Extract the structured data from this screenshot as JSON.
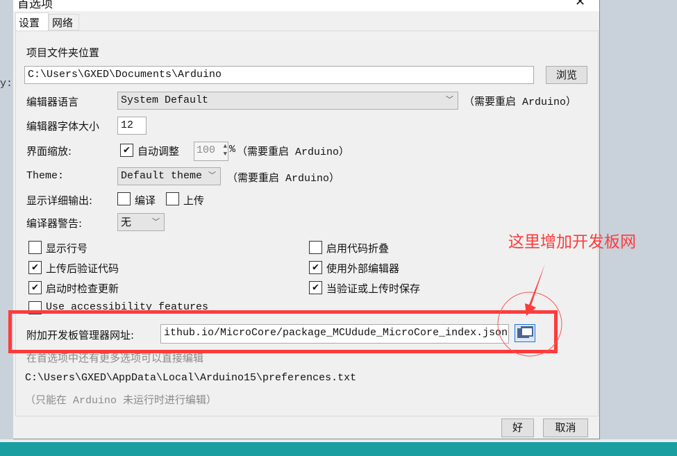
{
  "background": {
    "left_fragment": "y:"
  },
  "dialog": {
    "title": "首选项",
    "tabs": [
      {
        "label": "设置",
        "selected": true
      },
      {
        "label": "网络",
        "selected": false
      }
    ],
    "sketchbook_label": "项目文件夹位置",
    "sketchbook_path": "C:\\Users\\GXED\\Documents\\Arduino",
    "browse_label": "浏览",
    "editor_language_label": "编辑器语言",
    "editor_language_value": "System Default",
    "restart_note": "（需要重启 Arduino）",
    "font_size_label": "编辑器字体大小",
    "font_size_value": "12",
    "scale_label": "界面缩放:",
    "scale_auto_label": "自动调整",
    "scale_auto_checked": true,
    "scale_value": "100",
    "scale_unit": "%",
    "theme_label": "Theme:",
    "theme_value": "Default theme",
    "verbose_label": "显示详细输出:",
    "verbose_compile_label": "编译",
    "verbose_upload_label": "上传",
    "warnings_label": "编译器警告:",
    "warnings_value": "无",
    "options": [
      {
        "label": "显示行号",
        "checked": false
      },
      {
        "label": "启用代码折叠",
        "checked": false
      },
      {
        "label": "上传后验证代码",
        "checked": true
      },
      {
        "label": "使用外部编辑器",
        "checked": true
      },
      {
        "label": "启动时检查更新",
        "checked": true
      },
      {
        "label": "当验证或上传时保存",
        "checked": true
      },
      {
        "label": "Use accessibility features",
        "checked": false
      }
    ],
    "board_urls_label": "附加开发板管理器网址:",
    "board_urls_value": "ithub.io/MicroCore/package_MCUdude_MicroCore_index.json",
    "more_prefs_note": "在首选项中还有更多选项可以直接编辑",
    "prefs_path": "C:\\Users\\GXED\\AppData\\Local\\Arduino15\\preferences.txt",
    "edit_note": "（只能在 Arduino 未运行时进行编辑）",
    "ok_label": "好",
    "cancel_label": "取消"
  },
  "annotation": {
    "text": "这里增加开发板网",
    "color": "#ff3b3b"
  }
}
